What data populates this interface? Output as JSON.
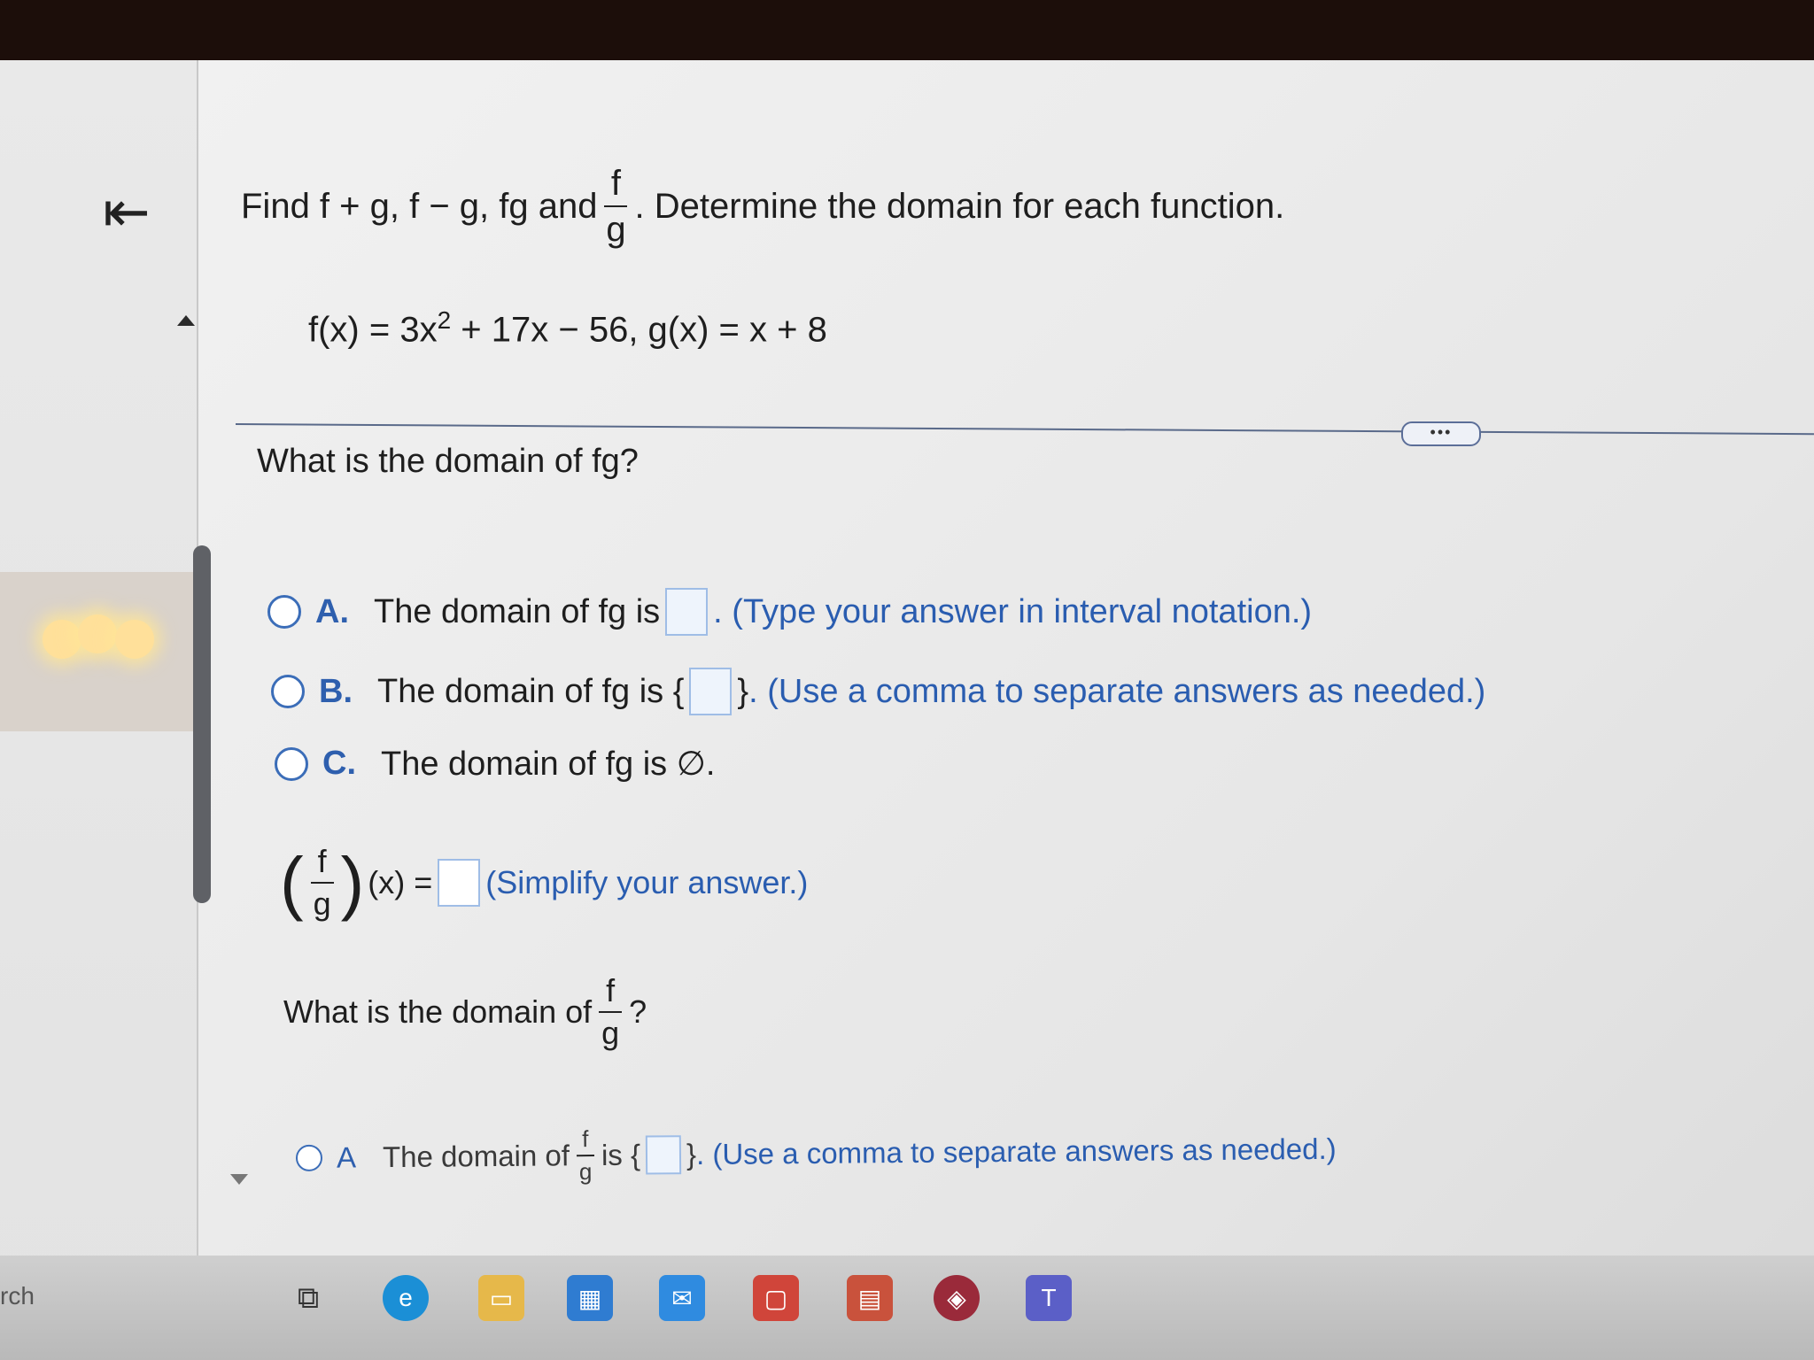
{
  "question": {
    "prefix": "Find f + g, f − g, fg and",
    "frac_num": "f",
    "frac_den": "g",
    "suffix": ". Determine the domain for each function.",
    "functions_part1": "f(x) = 3x",
    "functions_exp": "2",
    "functions_part2": " + 17x − 56, g(x) = x + 8"
  },
  "more_button": "•••",
  "fg_domain": {
    "question": "What is the domain of fg?",
    "options": [
      {
        "letter": "A.",
        "text": "The domain of fg is",
        "after": ". (Type your answer in interval notation.)"
      },
      {
        "letter": "B.",
        "text": "The domain of fg is {",
        "close": "}",
        "after": ". (Use a comma to separate answers as needed.)"
      },
      {
        "letter": "C.",
        "text": "The domain of fg is ∅."
      }
    ]
  },
  "quotient": {
    "num": "f",
    "den": "g",
    "lhs": "(x) =",
    "hint": "(Simplify your answer.)"
  },
  "fg_quot_domain": {
    "question": "What is the domain of",
    "num": "f",
    "den": "g",
    "qmark": "?",
    "option_a_letter": "A",
    "option_a_text": "The domain of",
    "option_a_after": "is {",
    "option_a_close": "}",
    "option_a_hint": ". (Use a comma to separate answers as needed.)"
  },
  "taskbar": {
    "search_partial": "rch"
  },
  "colors": {
    "accent_blue": "#2e5fae",
    "radio_blue": "#3b6db8"
  }
}
